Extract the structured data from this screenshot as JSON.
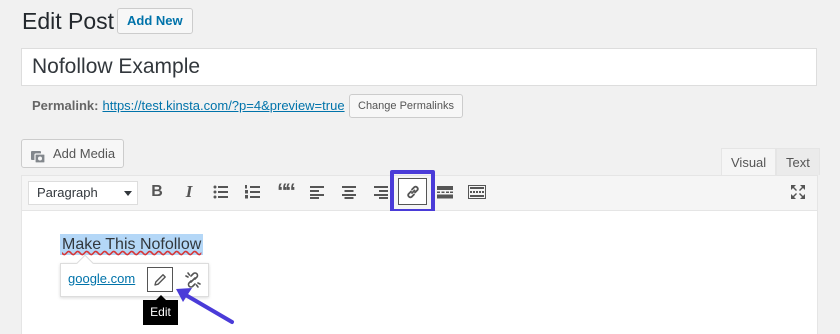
{
  "header": {
    "title": "Edit Post",
    "add_new_label": "Add New"
  },
  "post": {
    "title_value": "Nofollow Example"
  },
  "permalink": {
    "label": "Permalink:",
    "url": "https://test.kinsta.com/?p=4&preview=true",
    "change_label": "Change Permalinks"
  },
  "media": {
    "add_media_label": "Add Media",
    "icon": "media-camera-icon"
  },
  "tabs": {
    "visual": "Visual",
    "text": "Text",
    "active": "visual"
  },
  "toolbar": {
    "format_value": "Paragraph",
    "buttons": [
      "bold-icon",
      "italic-icon",
      "bulleted-list-icon",
      "numbered-list-icon",
      "blockquote-icon",
      "align-left-icon",
      "align-center-icon",
      "align-right-icon",
      "insert-link-icon",
      "read-more-icon",
      "toolbar-toggle-icon",
      "fullscreen-icon"
    ],
    "bold": "B",
    "italic": "I",
    "quote": "““",
    "highlight_color": "#4a3bd8"
  },
  "editor": {
    "selected_text": "Make This Nofollow",
    "link_popover": {
      "url": "google.com",
      "edit_tooltip": "Edit"
    }
  },
  "colors": {
    "accent": "#0073aa",
    "annotation": "#4a3bd8",
    "selection": "#b4d7f7"
  }
}
